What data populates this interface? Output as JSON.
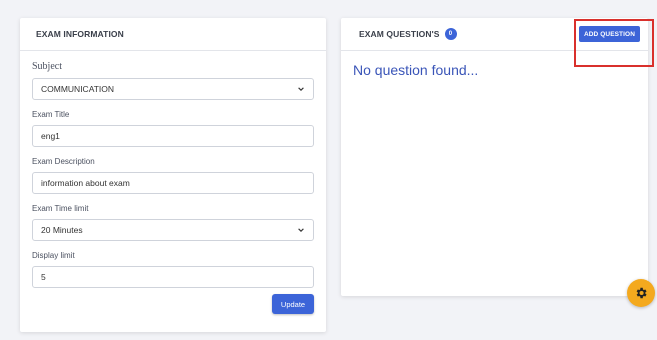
{
  "exam_info": {
    "header": "EXAM INFORMATION",
    "subject_label": "Subject",
    "subject_value": "COMMUNICATION",
    "title_label": "Exam Title",
    "title_value": "eng1",
    "description_label": "Exam Description",
    "description_value": "information about exam",
    "time_label": "Exam Time limit",
    "time_value": "20 Minutes",
    "display_label": "Display limit",
    "display_value": "5",
    "update_label": "Update"
  },
  "questions": {
    "header": "EXAM QUESTION'S",
    "count": "0",
    "add_label": "Add Question",
    "empty_text": "No question found..."
  },
  "colors": {
    "primary": "#3c64d8",
    "highlight": "#d9302c",
    "fab": "#f4a91e"
  },
  "icons": {
    "select_chevron": "chevron-down-icon",
    "fab": "gear-icon"
  }
}
